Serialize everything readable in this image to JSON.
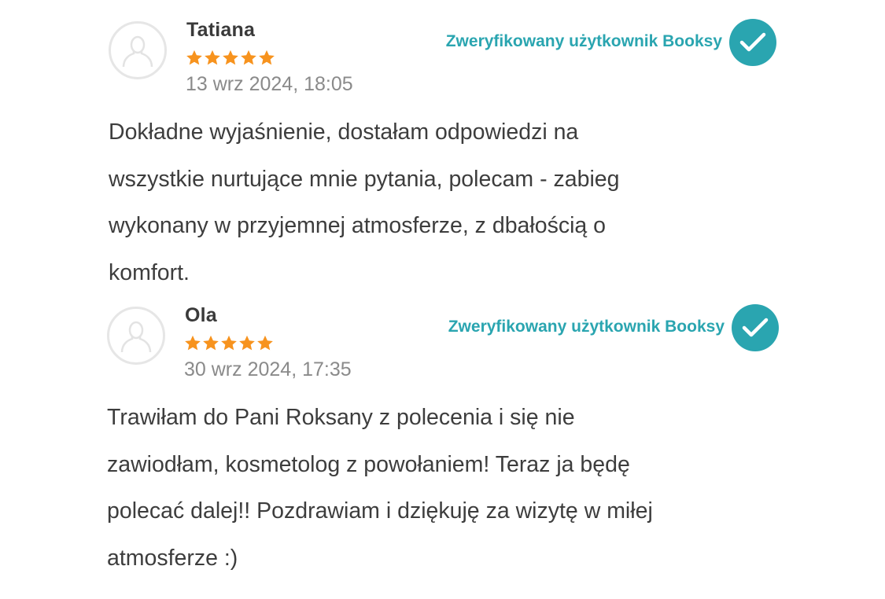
{
  "reviews": [
    {
      "author": "Tatiana",
      "rating": 5,
      "date": "13 wrz 2024, 18:05",
      "verified_label": "Zweryfikowany użytkownik Booksy",
      "text_lines": [
        "Dokładne wyjaśnienie, dostałam odpowiedzi na",
        "wszystkie nurtujące mnie pytania, polecam - zabieg",
        "wykonany w przyjemnej atmosferze, z dbałością o",
        "komfort."
      ]
    },
    {
      "author": "Ola",
      "rating": 5,
      "date": "30 wrz 2024, 17:35",
      "verified_label": "Zweryfikowany użytkownik Booksy",
      "text_lines": [
        "Trawiłam do Pani Roksany z polecenia i się nie",
        "zawiodłam, kosmetolog z powołaniem! Teraz ja będę",
        "polecać dalej!! Pozdrawiam i dziękuję za wizytę w miłej",
        "atmosferze :)"
      ]
    }
  ],
  "colors": {
    "accent": "#2aa5b0",
    "star": "#f7931e",
    "text": "#3d3d3d",
    "muted": "#8a8a8a"
  },
  "icons": {
    "avatar": "user-placeholder-icon",
    "star": "star-icon",
    "verified": "checkmark-icon"
  }
}
